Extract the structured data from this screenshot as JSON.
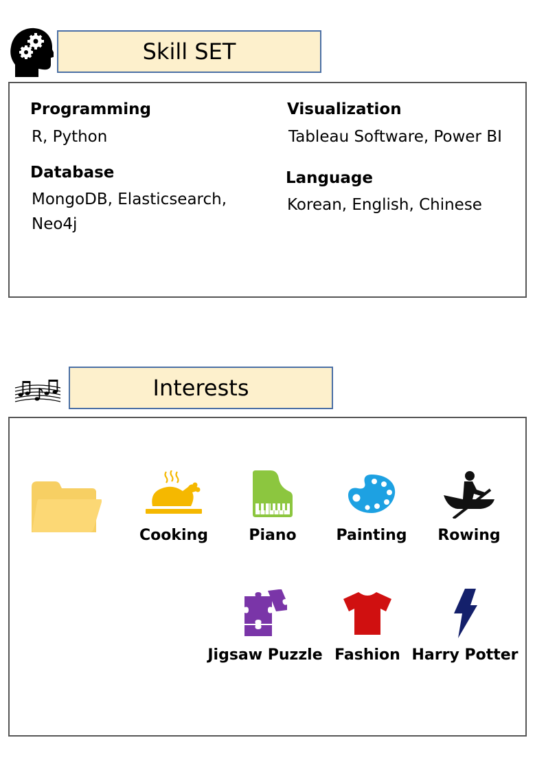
{
  "skills": {
    "icon": "head-gears-icon",
    "title": "Skill SET",
    "categories": [
      {
        "name": "Programming",
        "value": "R, Python"
      },
      {
        "name": "Database",
        "value_lines": [
          "MongoDB, Elasticsearch,",
          "Neo4j"
        ]
      },
      {
        "name": "Visualization",
        "value": "Tableau Software, Power BI"
      },
      {
        "name": "Language",
        "value": "Korean, English, Chinese"
      }
    ]
  },
  "interests": {
    "icon": "music-notes-icon",
    "title": "Interests",
    "folder_icon": "folder-icon",
    "items": [
      {
        "label": "Cooking",
        "icon": "roast-chicken-icon",
        "color": "#f5b800"
      },
      {
        "label": "Piano",
        "icon": "piano-icon",
        "color": "#8cc63f"
      },
      {
        "label": "Painting",
        "icon": "palette-icon",
        "color": "#1da1e2"
      },
      {
        "label": "Rowing",
        "icon": "rowing-icon",
        "color": "#111111"
      },
      {
        "label": "Jigsaw Puzzle",
        "icon": "puzzle-icon",
        "color": "#7a35a8"
      },
      {
        "label": "Fashion",
        "icon": "tshirt-icon",
        "color": "#d01010"
      },
      {
        "label": "Harry Potter",
        "icon": "lightning-bolt-icon",
        "color": "#14206b"
      }
    ]
  },
  "colors": {
    "banner_fill": "#fdf0cc",
    "banner_border": "#4a6fa5",
    "folder": "#fcd875"
  }
}
